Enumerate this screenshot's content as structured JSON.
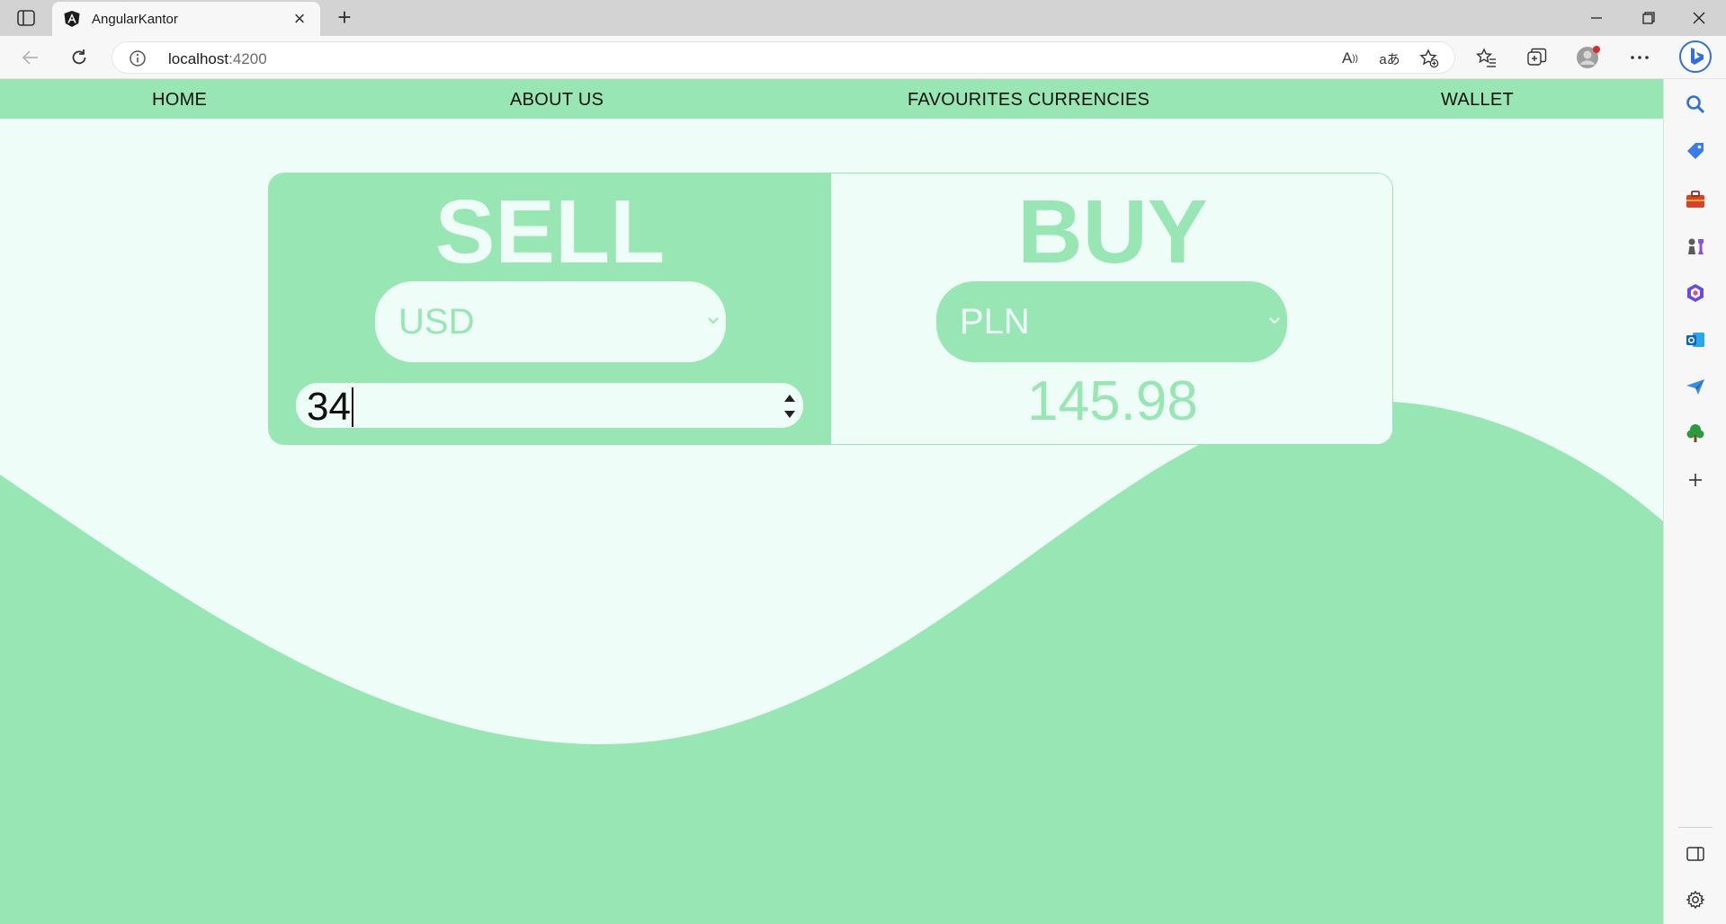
{
  "browser": {
    "tab_title": "AngularKantor",
    "url_host": "localhost",
    "url_port": ":4200",
    "read_aloud_glyph": "A",
    "translate_glyph": "aあ"
  },
  "nav": {
    "home": "HOME",
    "about": "ABOUT US",
    "favourites": "FAVOURITES CURRENCIES",
    "wallet": "WALLET"
  },
  "exchange": {
    "sell_title": "SELL",
    "buy_title": "BUY",
    "sell_currency": "USD",
    "buy_currency": "PLN",
    "amount": "34",
    "result": "145.98"
  },
  "colors": {
    "accent_green": "#98e6b3",
    "background_mint": "#effdf8"
  }
}
